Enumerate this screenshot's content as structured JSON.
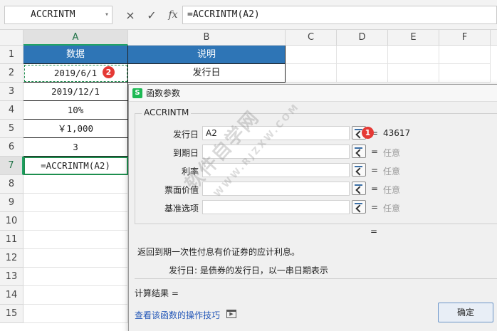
{
  "formula_bar": {
    "name_box": "ACCRINTM",
    "cancel_icon": "×",
    "confirm_icon": "✓",
    "fx_label": "fx",
    "formula": "=ACCRINTM(A2)"
  },
  "columns": [
    "A",
    "B",
    "C",
    "D",
    "E",
    "F"
  ],
  "rows": [
    "1",
    "2",
    "3",
    "4",
    "5",
    "6",
    "7",
    "8",
    "9",
    "10",
    "11",
    "12",
    "13",
    "14",
    "15"
  ],
  "cells": {
    "a1": "数据",
    "b1": "说明",
    "a2": "2019/6/1",
    "b2": "发行日",
    "a3": "2019/12/1",
    "a4": "10%",
    "a5": "￥1,000",
    "a6": "3",
    "a7": "=ACCRINTM(A2)"
  },
  "badges": {
    "first": "1",
    "second": "2"
  },
  "dialog": {
    "title": "函数参数",
    "app_icon": "S",
    "function_name": "ACCRINTM",
    "args": [
      {
        "label": "发行日",
        "value": "A2",
        "result": "43617"
      },
      {
        "label": "到期日",
        "value": "",
        "result": "任意"
      },
      {
        "label": "利率",
        "value": "",
        "result": "任意"
      },
      {
        "label": "票面价值",
        "value": "",
        "result": "任意"
      },
      {
        "label": "基准选项",
        "value": "",
        "result": "任意"
      }
    ],
    "eq": "=",
    "description": "返回到期一次性付息有价证券的应计利息。",
    "param_desc": "发行日:  是债券的发行日，以一串日期表示",
    "calc_result": "计算结果 =",
    "help_link": "查看该函数的操作技巧",
    "ok_label": "确定"
  },
  "watermark": {
    "main": "软件自学网",
    "sub": "WWW.RJZXW.COM"
  }
}
